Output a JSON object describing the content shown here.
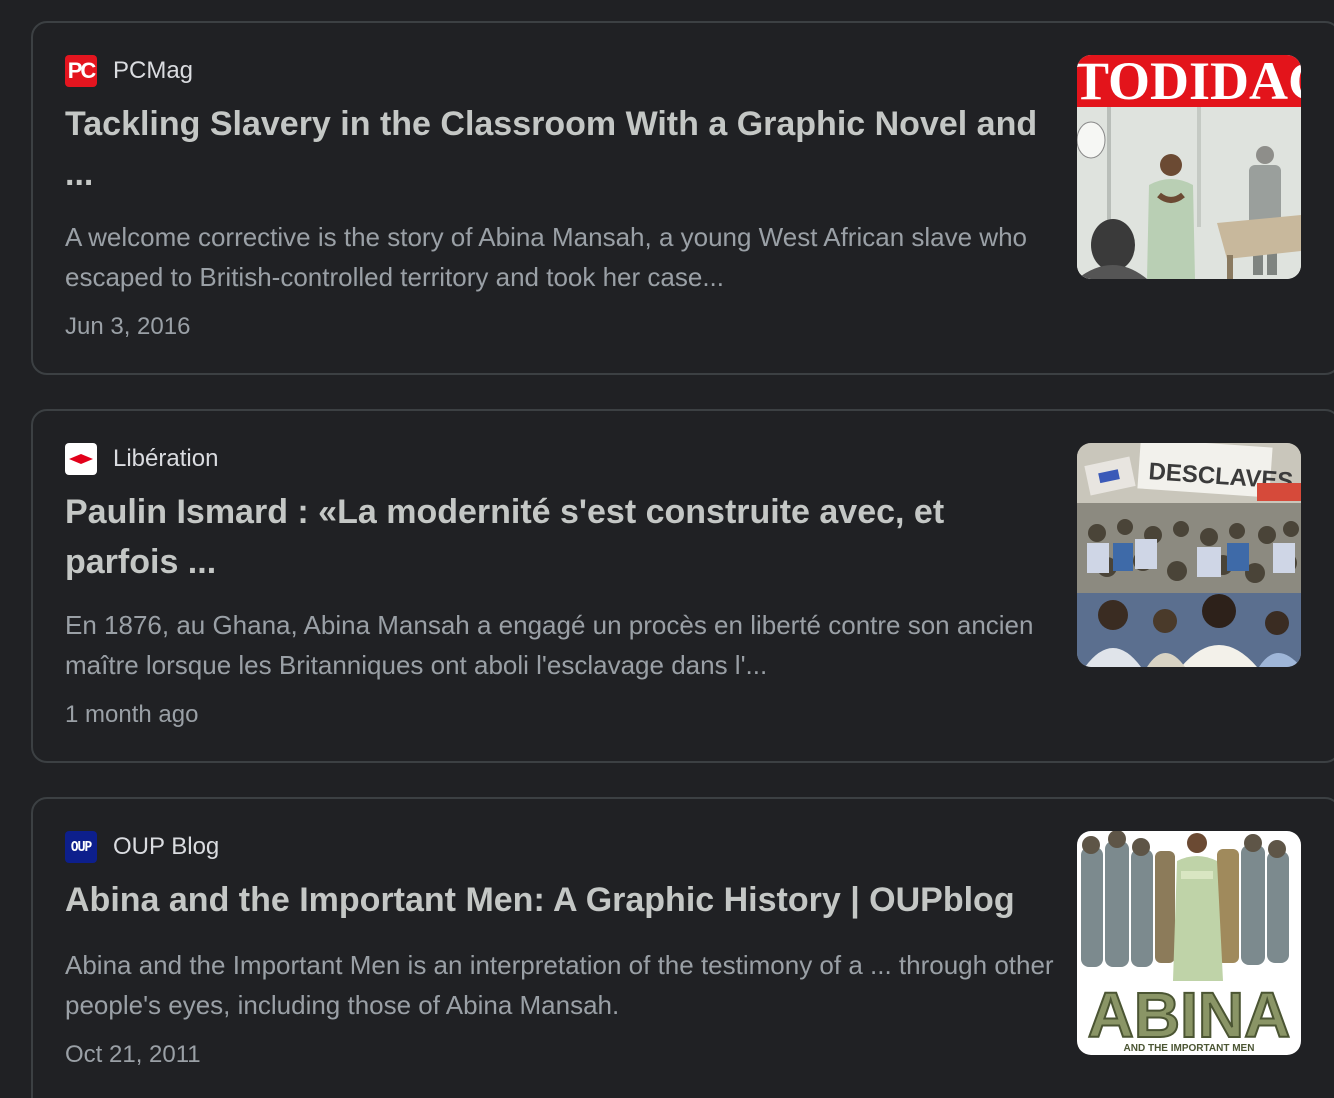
{
  "results": [
    {
      "source": "PCMag",
      "favicon": "pcmag-logo-icon",
      "title": "Tackling Slavery in the Classroom With a Graphic Novel and ...",
      "snippet": "A welcome corrective is the story of Abina Mansah, a young West African slave who escaped to British-controlled territory and took her case...",
      "date": "Jun 3, 2016",
      "thumbnail_text": "TODIDAC"
    },
    {
      "source": "Libération",
      "favicon": "liberation-logo-icon",
      "title": "Paulin Ismard : «La modernité s'est construite avec, et parfois ...",
      "snippet": "En 1876, au Ghana, Abina Mansah a engagé un procès en liberté contre son ancien maître lorsque les Britanniques ont aboli l'esclavage dans l'...",
      "date": "1 month ago",
      "thumbnail_text": "DESCLAVES"
    },
    {
      "source": "OUP Blog",
      "favicon": "oup-logo-icon",
      "favicon_text": "OUP",
      "title": "Abina and the Important Men: A Graphic History | OUPblog",
      "snippet": "Abina and the Important Men is an interpretation of the testimony of a ... through other people's eyes, including those of Abina Mansah.",
      "date": "Oct 21, 2011",
      "thumbnail_text": "ABINA",
      "thumbnail_subtext": "AND THE IMPORTANT MEN"
    }
  ],
  "colors": {
    "background": "#202124",
    "card_border": "#3c4043",
    "title": "#c4c7c5",
    "text": "#9aa0a6",
    "source": "#dadce0"
  }
}
